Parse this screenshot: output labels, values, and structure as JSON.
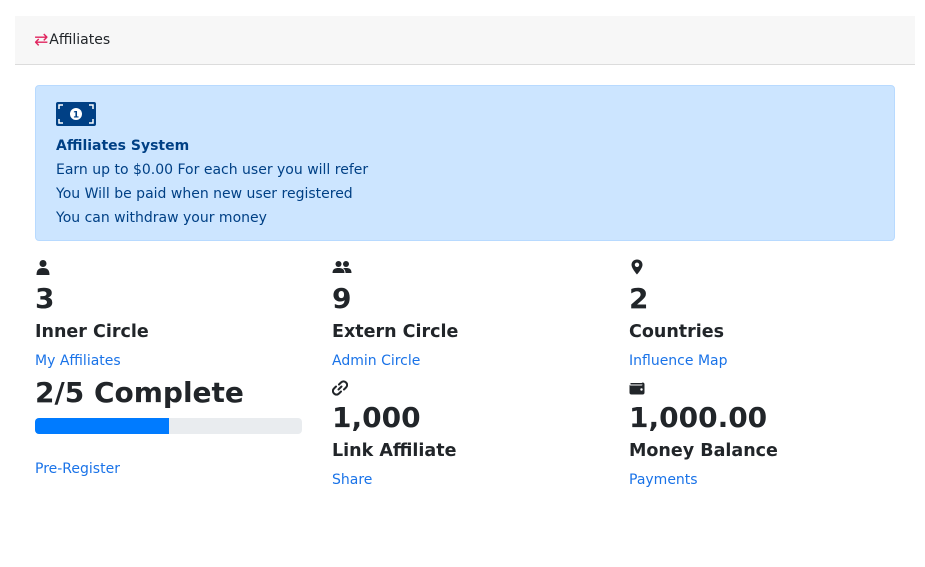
{
  "header": {
    "icon": "exchange-arrows-icon",
    "title": "Affiliates"
  },
  "alert": {
    "icon": "money-bill-icon",
    "title": "Affiliates System",
    "lines": [
      "Earn up to $0.00 For each user you will refer",
      "You Will be paid when new user registered",
      "You can withdraw your money"
    ]
  },
  "stats": {
    "inner": {
      "icon": "user-icon",
      "value": "3",
      "label": "Inner Circle",
      "link": "My Affiliates"
    },
    "extern": {
      "icon": "users-icon",
      "value": "9",
      "label": "Extern Circle",
      "link": "Admin Circle"
    },
    "countries": {
      "icon": "map-marker-icon",
      "value": "2",
      "label": "Countries",
      "link": "Influence Map"
    },
    "complete": {
      "text": "2/5 Complete",
      "progress": 0.5,
      "link": "Pre-Register"
    },
    "link_affiliate": {
      "icon": "link-icon",
      "value": "1,000",
      "label": "Link Affiliate",
      "link": "Share"
    },
    "money": {
      "icon": "wallet-icon",
      "value": "1,000.00",
      "label": "Money Balance",
      "link": "Payments"
    }
  },
  "colors": {
    "accent": "#007bff",
    "link": "#1a73e8",
    "alert_bg": "#cce5ff",
    "alert_text": "#004085",
    "swap_icon": "#e0245e"
  }
}
